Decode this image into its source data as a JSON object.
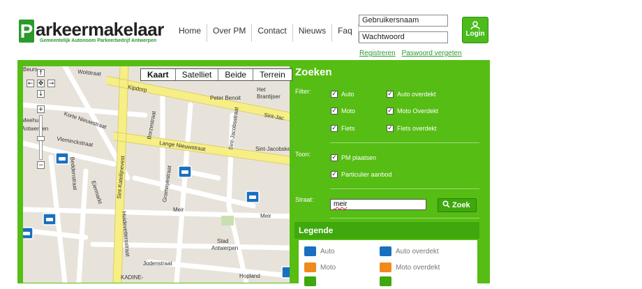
{
  "brand": {
    "letter": "P",
    "name": "arkeermakelaar",
    "subtitle": "Gemeentelijk Autonoom Parkeerbedrijf Antwerpen"
  },
  "nav": [
    "Home",
    "Over PM",
    "Contact",
    "Nieuws",
    "Faq"
  ],
  "login": {
    "username_placeholder": "Gebruikersnaam",
    "password_placeholder": "Wachtwoord",
    "register": "Registreren",
    "forgot": "Paswoord vergeten",
    "button": "Login"
  },
  "map": {
    "types": [
      "Kaart",
      "Satelliet",
      "Beide",
      "Terrein"
    ],
    "active_type": "Kaart",
    "labels": {
      "wolstraat": "Wolstraat",
      "beurs": "Beurs",
      "kipdorp": "Kipdorp",
      "peter_benoit": "Peter Benoit",
      "het": "Het",
      "brantijser": "Brantijser",
      "sint_jac": "Sint-Jac",
      "korte_nieuwstraat": "Korte Nieuwstraat",
      "borzestraat": "Borzestraat",
      "meehuis": "Meehuis",
      "antwerpen_side": "Antwerpen",
      "vleminck": "Vleminckstraat",
      "lange_nieuwstraat": "Lange Nieuwstraat",
      "sint_jacobsstraat": "Sint-Jacobsstraat",
      "sint_jacobskerk": "Sint-Jacobsker",
      "sint_katelijnevest": "Sint-Katelijnevest",
      "eiermarkt": "Eiermarkt",
      "beddenstraat": "Beddenstraat",
      "gramayestraat": "Gramayestraat",
      "huidevettersstraat": "Huidevettersstraat",
      "meir1": "Meir",
      "meir2": "Meir",
      "stad": "Stad",
      "antwerpen": "Antwerpen",
      "jodenstraat": "Jodenstraat",
      "hopland": "Hopland",
      "kadine": "KADINE-"
    }
  },
  "search": {
    "title": "Zoeken",
    "filter_label": "Filter:",
    "filters": [
      "Auto",
      "Auto overdekt",
      "Moto",
      "Moto Overdekt",
      "Fiets",
      "Fiets overdekt"
    ],
    "toon_label": "Toon:",
    "toon": [
      "PM plaatsen",
      "Particulier aanbod"
    ],
    "straat_label": "Straat:",
    "straat_value": "meir",
    "zoek_button": "Zoek"
  },
  "legende": {
    "title": "Legende",
    "items": [
      {
        "label": "Auto",
        "color": "#1a6fc0"
      },
      {
        "label": "Auto overdekt",
        "color": "#1a6fc0"
      },
      {
        "label": "Moto",
        "color": "#f08a1c"
      },
      {
        "label": "Moto overdekt",
        "color": "#f08a1c"
      }
    ]
  }
}
